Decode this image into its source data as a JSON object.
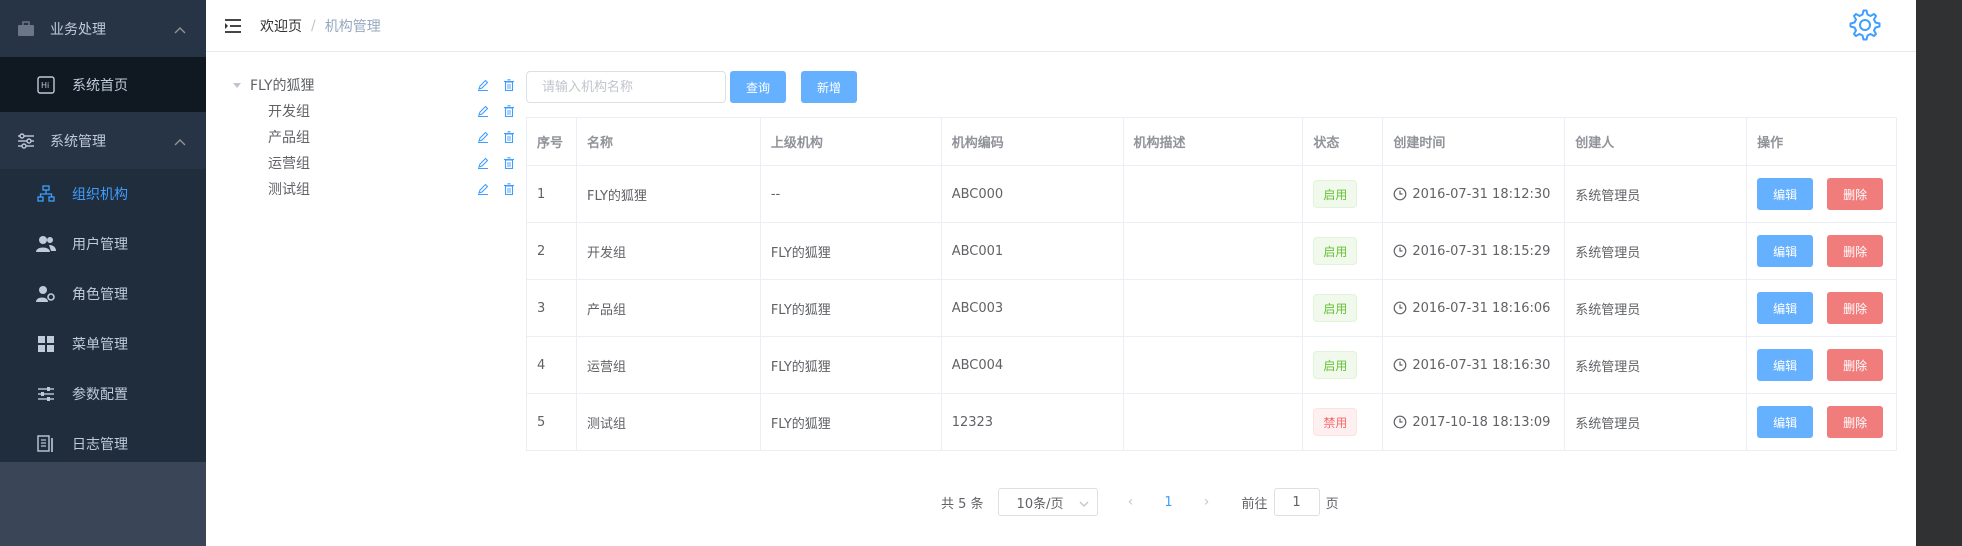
{
  "colors": {
    "sidebar_bg": "#304156",
    "accent": "#409eff",
    "success": "#67c23a",
    "danger": "#f56c6c"
  },
  "sidebar": {
    "group1": {
      "label": "业务处理",
      "icon": "briefcase-icon"
    },
    "home": {
      "label": "系统首页",
      "icon": "hi-icon"
    },
    "group2": {
      "label": "系统管理",
      "icon": "sliders-icon"
    },
    "items": [
      {
        "label": "组织机构",
        "icon": "org-chart-icon",
        "active": true
      },
      {
        "label": "用户管理",
        "icon": "users-icon"
      },
      {
        "label": "角色管理",
        "icon": "user-gear-icon"
      },
      {
        "label": "菜单管理",
        "icon": "grid-icon"
      },
      {
        "label": "参数配置",
        "icon": "settings-sliders-icon"
      },
      {
        "label": "日志管理",
        "icon": "log-icon"
      }
    ]
  },
  "header": {
    "breadcrumb_home": "欢迎页",
    "breadcrumb_sep": "/",
    "breadcrumb_current": "机构管理"
  },
  "tree": {
    "root": "FLY的狐狸",
    "children": [
      "开发组",
      "产品组",
      "运营组",
      "测试组"
    ]
  },
  "toolbar": {
    "search_placeholder": "请输入机构名称",
    "query_label": "查询",
    "add_label": "新增"
  },
  "table": {
    "headers": [
      "序号",
      "名称",
      "上级机构",
      "机构编码",
      "机构描述",
      "状态",
      "创建时间",
      "创建人",
      "操作"
    ],
    "rows": [
      {
        "index": "1",
        "name": "FLY的狐狸",
        "parent": "--",
        "code": "ABC000",
        "desc": "",
        "status": "启用",
        "enabled": true,
        "created": "2016-07-31 18:12:30",
        "creator": "系统管理员"
      },
      {
        "index": "2",
        "name": "开发组",
        "parent": "FLY的狐狸",
        "code": "ABC001",
        "desc": "",
        "status": "启用",
        "enabled": true,
        "created": "2016-07-31 18:15:29",
        "creator": "系统管理员"
      },
      {
        "index": "3",
        "name": "产品组",
        "parent": "FLY的狐狸",
        "code": "ABC003",
        "desc": "",
        "status": "启用",
        "enabled": true,
        "created": "2016-07-31 18:16:06",
        "creator": "系统管理员"
      },
      {
        "index": "4",
        "name": "运营组",
        "parent": "FLY的狐狸",
        "code": "ABC004",
        "desc": "",
        "status": "启用",
        "enabled": true,
        "created": "2016-07-31 18:16:30",
        "creator": "系统管理员"
      },
      {
        "index": "5",
        "name": "测试组",
        "parent": "FLY的狐狸",
        "code": "12323",
        "desc": "",
        "status": "禁用",
        "enabled": false,
        "created": "2017-10-18 18:13:09",
        "creator": "系统管理员"
      }
    ],
    "edit_label": "编辑",
    "delete_label": "删除"
  },
  "pagination": {
    "total_text": "共 5 条",
    "page_size": "10条/页",
    "current_page": "1",
    "goto_prefix": "前往",
    "goto_value": "1",
    "goto_suffix": "页"
  }
}
